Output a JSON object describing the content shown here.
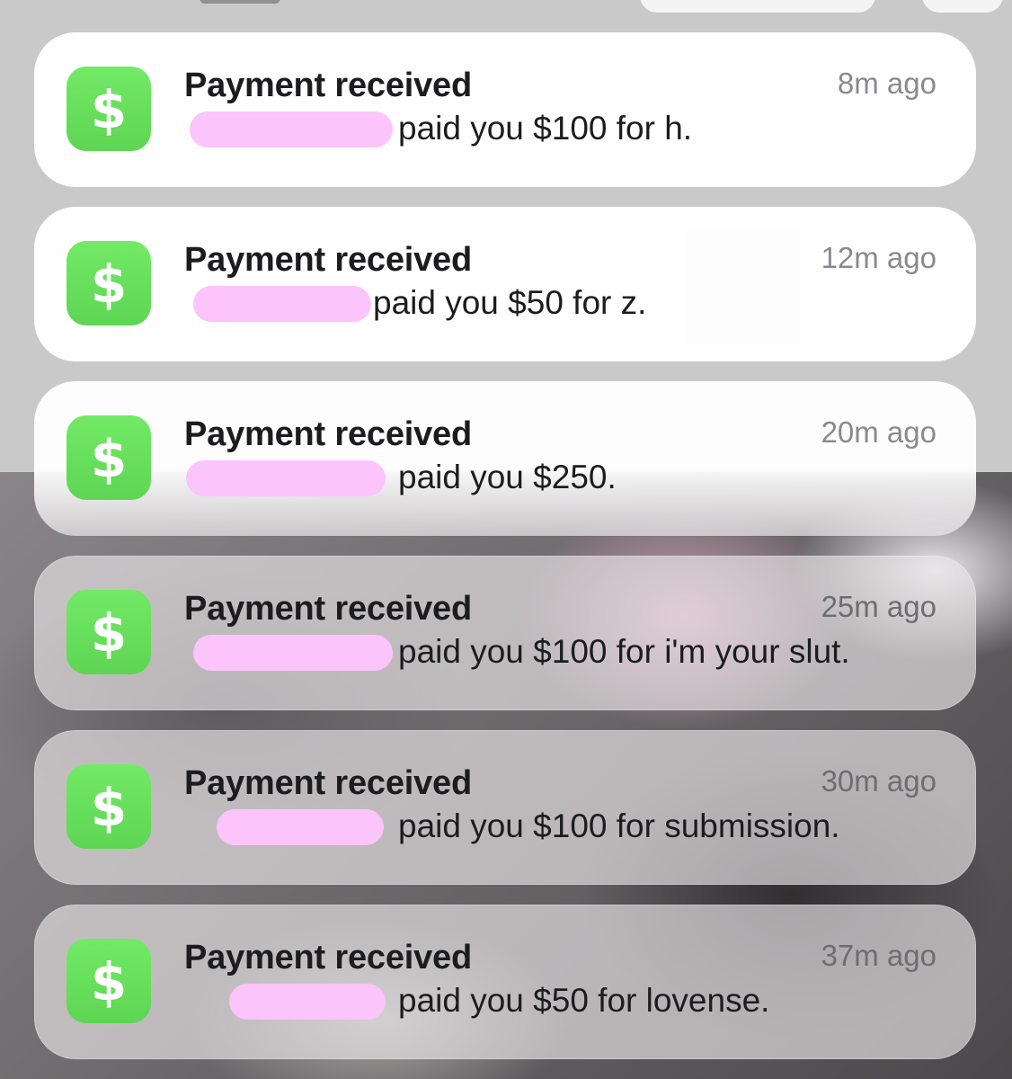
{
  "app": {
    "icon": "cash-app-dollar-icon",
    "glyph": "$",
    "accent": "#64dc57"
  },
  "redaction_color": "#fbc4fa",
  "notifications": [
    {
      "title": "Payment received",
      "time": "8m ago",
      "message": "paid you $100 for h."
    },
    {
      "title": "Payment received",
      "time": "12m ago",
      "message": "paid you $50 for z."
    },
    {
      "title": "Payment received",
      "time": "20m ago",
      "message": "paid you $250."
    },
    {
      "title": "Payment received",
      "time": "25m ago",
      "message": "paid you $100 for i'm your slut."
    },
    {
      "title": "Payment received",
      "time": "30m ago",
      "message": "paid you $100 for submission."
    },
    {
      "title": "Payment received",
      "time": "37m ago",
      "message": "paid you $50 for lovense."
    }
  ]
}
